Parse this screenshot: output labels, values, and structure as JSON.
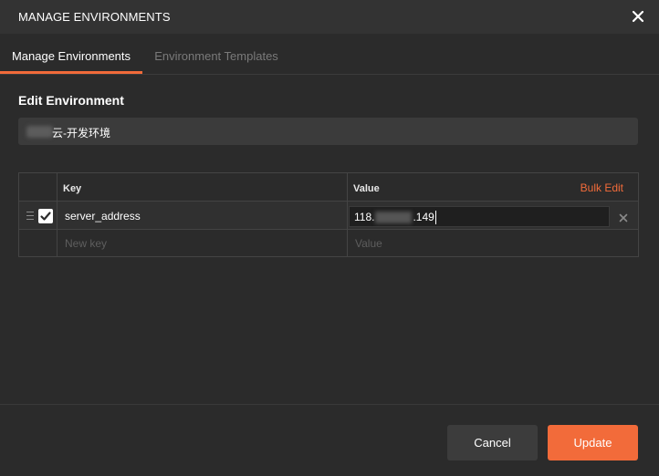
{
  "header": {
    "title": "MANAGE ENVIRONMENTS",
    "close_icon": "close-icon"
  },
  "tabs": [
    {
      "label": "Manage Environments",
      "active": true
    },
    {
      "label": "Environment Templates",
      "active": false
    }
  ],
  "edit": {
    "heading": "Edit Environment",
    "name_visible": "云-开发环境"
  },
  "table": {
    "columns": {
      "key": "Key",
      "value": "Value"
    },
    "bulk_edit": "Bulk Edit",
    "rows": [
      {
        "enabled": true,
        "key": "server_address",
        "value_prefix": "118.",
        "value_suffix": ".149"
      }
    ],
    "new_key_placeholder": "New key",
    "new_value_placeholder": "Value"
  },
  "footer": {
    "cancel_label": "Cancel",
    "update_label": "Update"
  },
  "colors": {
    "accent": "#f26b3a",
    "background": "#2b2b2b",
    "header": "#333333"
  }
}
